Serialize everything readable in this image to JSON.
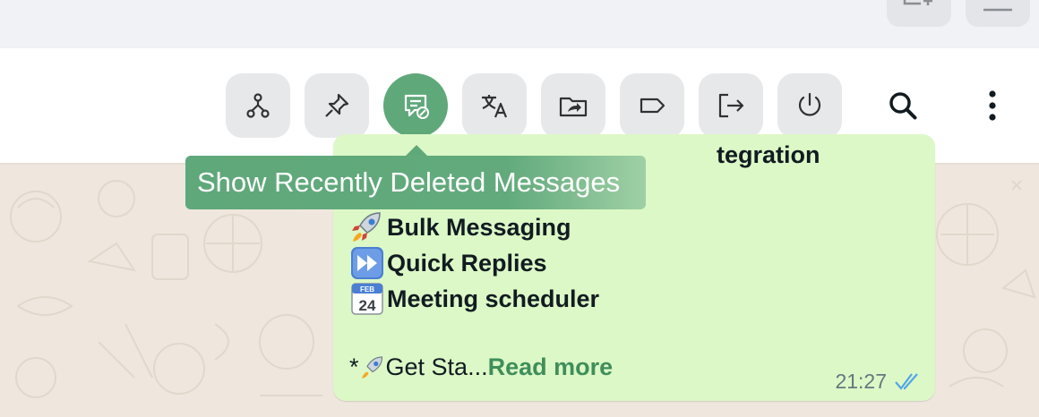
{
  "toolbar": {
    "buttons": [
      {
        "name": "branch-icon",
        "active": false
      },
      {
        "name": "pin-icon",
        "active": false
      },
      {
        "name": "deleted-messages-icon",
        "active": true
      },
      {
        "name": "translate-icon",
        "active": false
      },
      {
        "name": "folder-share-icon",
        "active": false
      },
      {
        "name": "label-icon",
        "active": false
      },
      {
        "name": "logout-icon",
        "active": false
      },
      {
        "name": "power-icon",
        "active": false
      },
      {
        "name": "search-icon",
        "active": false
      },
      {
        "name": "more-vertical-icon",
        "active": false
      }
    ],
    "active_color": "#5fa87a"
  },
  "tooltip": {
    "text": "Show Recently Deleted Messages"
  },
  "message": {
    "partial_line": "tegration",
    "features": [
      {
        "icon": "rocket-icon",
        "label": "Bulk Messaging"
      },
      {
        "icon": "fast-forward-icon",
        "label": "Quick Replies"
      },
      {
        "icon": "calendar-icon",
        "label": "Meeting scheduler"
      }
    ],
    "calendar_month": "FEB",
    "calendar_day": "24",
    "cta_prefix": "*",
    "cta_text": " Get Sta...",
    "read_more": "Read more",
    "time": "21:27",
    "status": "read",
    "bubble_color": "#dcf8c6"
  }
}
